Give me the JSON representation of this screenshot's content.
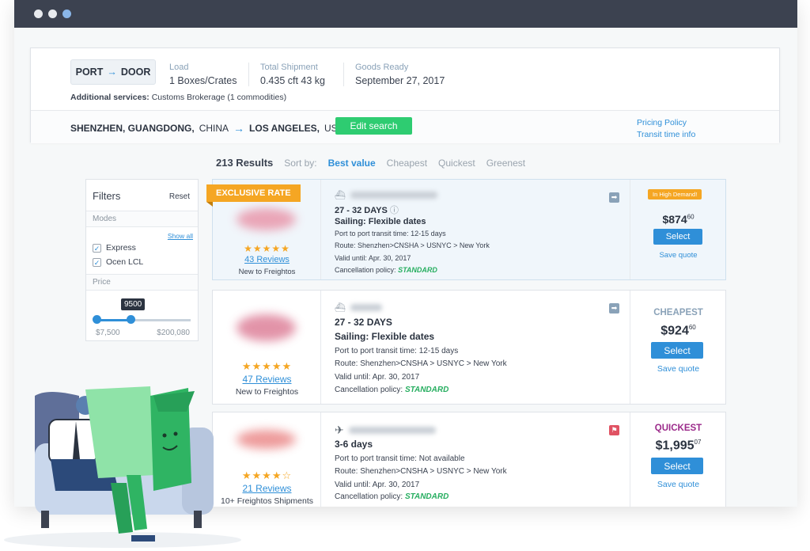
{
  "summary": {
    "mode_from": "PORT",
    "mode_to": "DOOR",
    "load_label": "Load",
    "load_value": "1 Boxes/Crates",
    "total_label": "Total Shipment",
    "total_value": "0.435 cft 43 kg",
    "ready_label": "Goods Ready",
    "ready_value": "September 27, 2017",
    "additional_label": "Additional services:",
    "additional_value": "Customs Brokerage (1 commodities)",
    "origin_city": "SHENZHEN, GUANGDONG,",
    "origin_country": "CHINA",
    "dest_city": "LOS ANGELES,",
    "dest_country": "USA",
    "edit_label": "Edit search",
    "pricing_policy": "Pricing Policy",
    "transit_info": "Transit time info"
  },
  "results": {
    "count": "213 Results",
    "sort_label": "Sort by:",
    "sort_options": [
      "Best value",
      "Cheapest",
      "Quickest",
      "Greenest"
    ]
  },
  "filters": {
    "title": "Filters",
    "reset": "Reset",
    "modes_label": "Modes",
    "show_all": "Show all",
    "mode_options": [
      "Express",
      "Ocen LCL"
    ],
    "price_label": "Price",
    "price_current": "9500",
    "price_min": "$7,500",
    "price_max": "$200,080",
    "slider_fraction": 0.37
  },
  "cards": [
    {
      "ribbon": "EXCLUSIVE RATE",
      "stars": "★★★★★",
      "reviews": "43 Reviews",
      "tagline": "New to Freightos",
      "days": "27 - 32 DAYS",
      "sailing": "Sailing: Flexible dates",
      "transit_label": "Port to port transit time:",
      "transit_value": "12-15 days",
      "route_label": "Route:",
      "route_value": "Shenzhen>CNSHA > USNYC > New York",
      "valid_label": "Valid until:",
      "valid_value": "Apr. 30, 2017",
      "cancel_label": "Cancellation policy:",
      "cancel_value": "STANDARD",
      "badge": "In High Demand!",
      "price_main": "$874",
      "price_cents": "60",
      "select": "Select",
      "save": "Save quote"
    },
    {
      "stars": "★★★★★",
      "reviews": "47 Reviews",
      "tagline": "New to Freightos",
      "days": "27 - 32 DAYS",
      "sailing": "Sailing: Flexible dates",
      "transit_label": "Port to port transit time:",
      "transit_value": "12-15 days",
      "route_label": "Route:",
      "route_value": "Shenzhen>CNSHA > USNYC > New York",
      "valid_label": "Valid until:",
      "valid_value": "Apr. 30, 2017",
      "cancel_label": "Cancellation policy:",
      "cancel_value": "STANDARD",
      "tag": "CHEAPEST",
      "price_main": "$924",
      "price_cents": "60",
      "select": "Select",
      "save": "Save quote"
    },
    {
      "stars": "★★★★☆",
      "reviews": "21 Reviews",
      "tagline": "10+ Freightos Shipments",
      "days": "3-6 days",
      "transit_label": "Port to port transit time:",
      "transit_value": "Not available",
      "route_label": "Route:",
      "route_value": "Shenzhen>CNSHA > USNYC > New York",
      "valid_label": "Valid until:",
      "valid_value": "Apr. 30, 2017",
      "cancel_label": "Cancellation policy:",
      "cancel_value": "STANDARD",
      "tag": "QUICKEST",
      "price_main": "$1,995",
      "price_cents": "07",
      "select": "Select",
      "save": "Save quote"
    }
  ],
  "colors": {
    "accent": "#2f8fd8",
    "green": "#2ecc71",
    "orange": "#f5a623",
    "quickest": "#9b2a8a"
  }
}
